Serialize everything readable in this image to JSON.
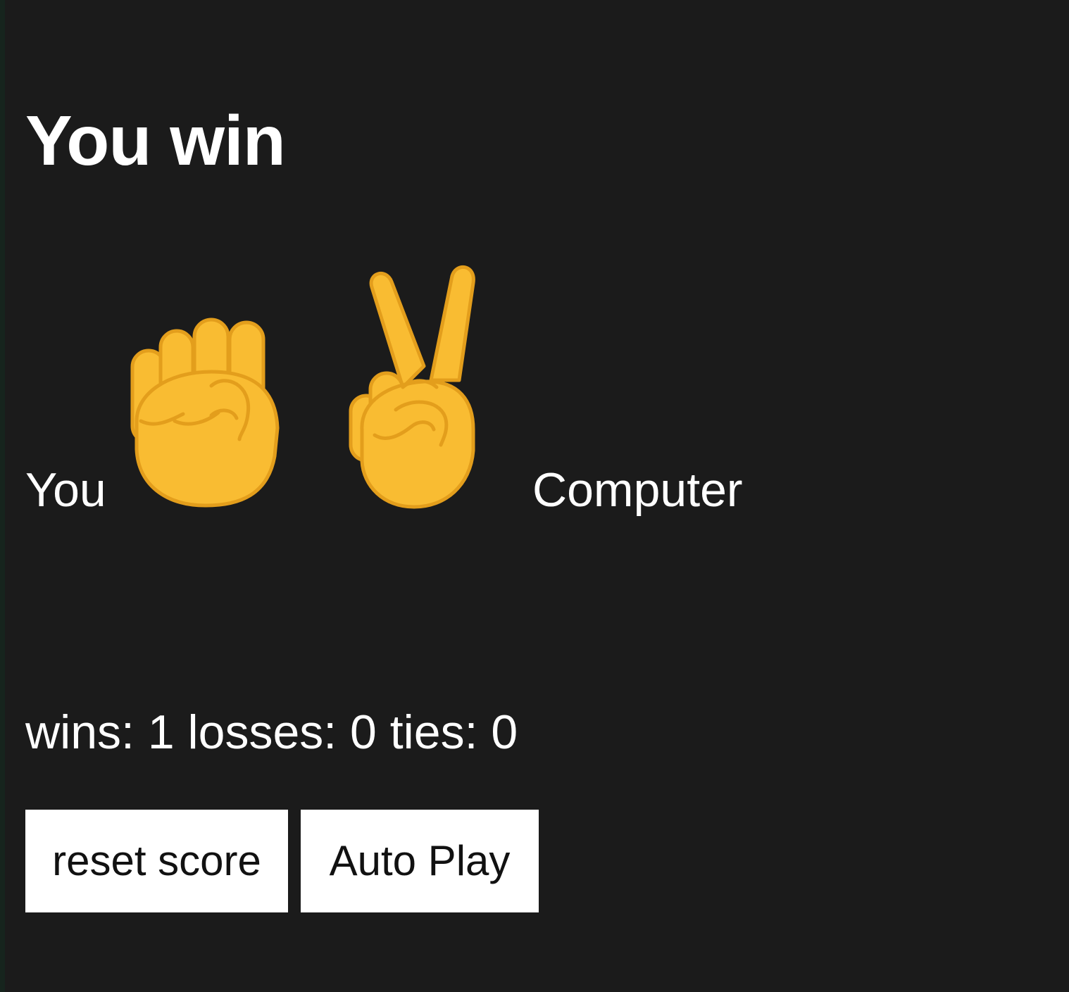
{
  "game": {
    "result_text": "You win",
    "player_label": "You",
    "computer_label": "Computer",
    "player_move_icon": "raised-fist",
    "computer_move_icon": "victory-hand",
    "score_text": "wins: 1 losses: 0 ties: 0",
    "score": {
      "wins": 1,
      "losses": 0,
      "ties": 0
    }
  },
  "controls": {
    "reset_label": "reset score",
    "auto_play_label": "Auto Play"
  },
  "colors": {
    "background": "#1b1b1b",
    "text": "#ffffff",
    "button_background": "#ffffff",
    "button_text": "#111111",
    "emoji_skin": "#f9bc32",
    "emoji_outline": "#e39e1c"
  }
}
